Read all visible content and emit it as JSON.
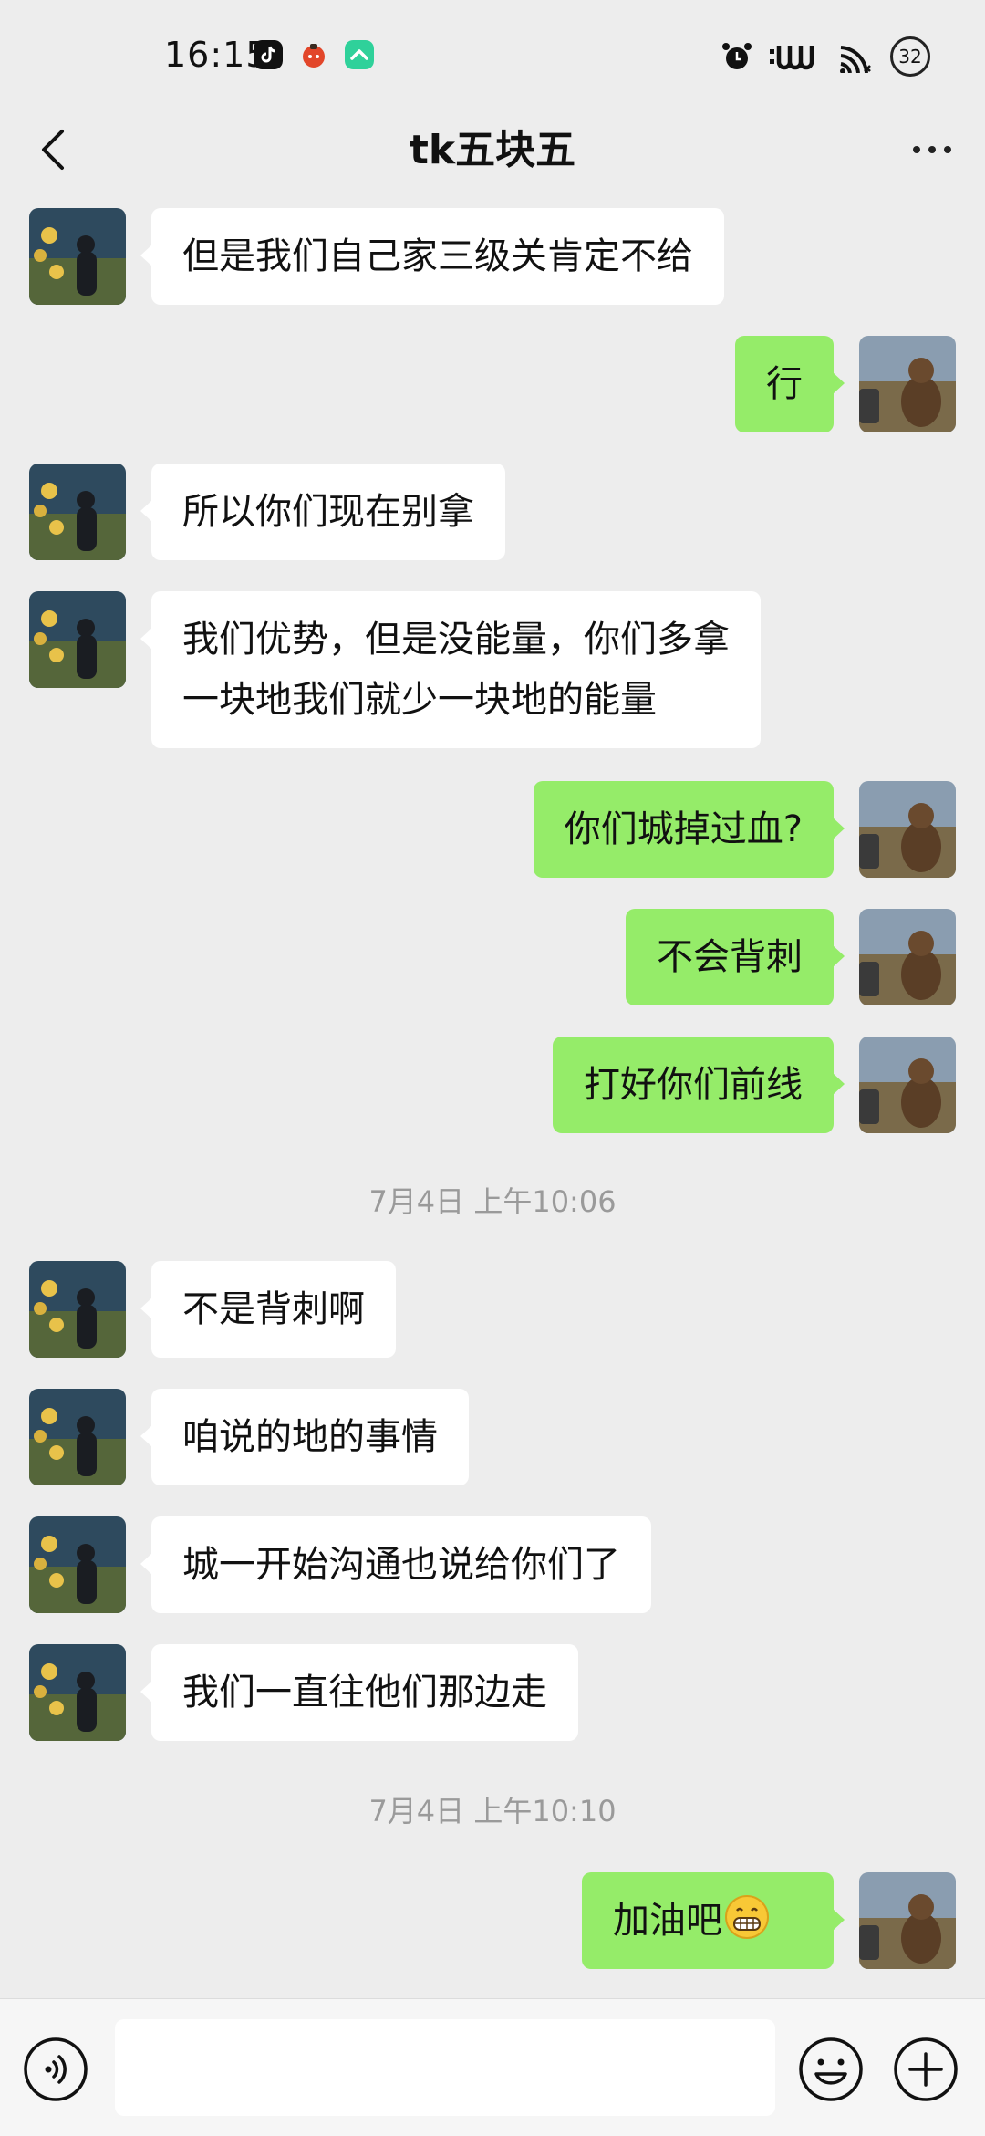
{
  "status_bar": {
    "time": "16:15",
    "battery": "32"
  },
  "chat": {
    "title": "tk五块五"
  },
  "messages": [
    {
      "side": "left",
      "lines": [
        "但是我们自己家三级关肯定不给"
      ]
    },
    {
      "side": "right",
      "lines": [
        "行"
      ]
    },
    {
      "side": "left",
      "lines": [
        "所以你们现在别拿"
      ]
    },
    {
      "side": "left",
      "lines": [
        "我们优势，但是没能量，你们多拿",
        "一块地我们就少一块地的能量"
      ]
    },
    {
      "side": "right",
      "lines": [
        "你们城掉过血?"
      ]
    },
    {
      "side": "right",
      "lines": [
        "不会背刺"
      ]
    },
    {
      "side": "right",
      "lines": [
        "打好你们前线"
      ]
    },
    {
      "timestamp": "7月4日 上午10:06"
    },
    {
      "side": "left",
      "lines": [
        "不是背刺啊"
      ]
    },
    {
      "side": "left",
      "lines": [
        "咱说的地的事情"
      ]
    },
    {
      "side": "left",
      "lines": [
        "城一开始沟通也说给你们了"
      ]
    },
    {
      "side": "left",
      "lines": [
        "我们一直往他们那边走"
      ]
    },
    {
      "timestamp": "7月4日 上午10:10"
    },
    {
      "side": "right",
      "lines": [
        "加油吧"
      ],
      "emoji": "grinning-emoji"
    }
  ],
  "input_bar": {
    "placeholder": "",
    "value": ""
  },
  "icons": {
    "back": "chevron-left-icon",
    "more": "more-dots-icon",
    "voice": "voice-icon",
    "emoji": "emoji-icon",
    "plus": "plus-icon"
  },
  "colors": {
    "background": "#ededed",
    "sent_bubble": "#95ec69",
    "received_bubble": "#ffffff",
    "timestamp_text": "#9a9a9a"
  }
}
